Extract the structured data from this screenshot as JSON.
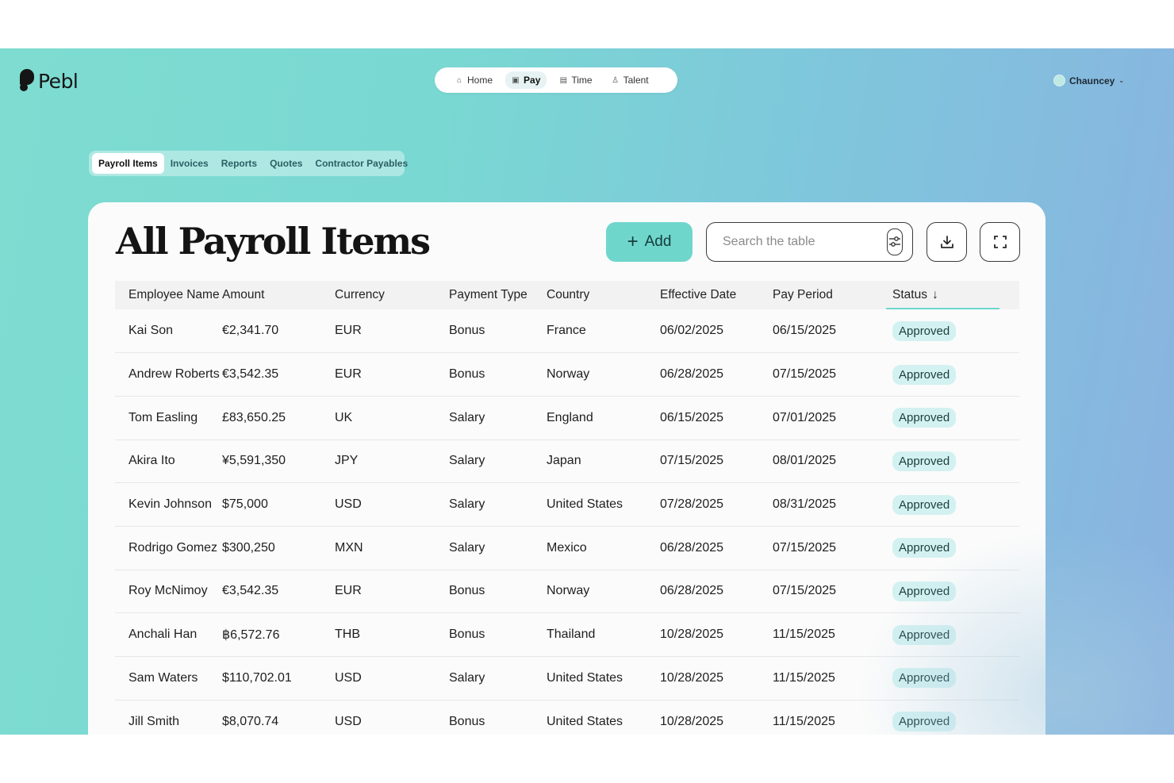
{
  "brand": {
    "name": "Pebl"
  },
  "topnav": {
    "items": [
      {
        "label": "Home",
        "icon": "home-icon"
      },
      {
        "label": "Pay",
        "icon": "wallet-icon",
        "active": true
      },
      {
        "label": "Time",
        "icon": "calendar-icon"
      },
      {
        "label": "Talent",
        "icon": "person-icon"
      }
    ]
  },
  "user": {
    "name": "Chauncey"
  },
  "subtabs": [
    {
      "label": "Payroll Items",
      "active": true
    },
    {
      "label": "Invoices"
    },
    {
      "label": "Reports"
    },
    {
      "label": "Quotes"
    },
    {
      "label": "Contractor Payables"
    }
  ],
  "main": {
    "title": "All Payroll Items",
    "add_label": "Add",
    "search_placeholder": "Search the table"
  },
  "table": {
    "columns": [
      "Employee Name",
      "Amount",
      "Currency",
      "Payment Type",
      "Country",
      "Effective Date",
      "Pay Period",
      "Status"
    ],
    "sorted_by": "Status",
    "rows": [
      {
        "name": "Kai Son",
        "amount": "€2,341.70",
        "currency": "EUR",
        "type": "Bonus",
        "country": "France",
        "effective": "06/02/2025",
        "period": "06/15/2025",
        "status": "Approved"
      },
      {
        "name": "Andrew Roberts",
        "amount": "€3,542.35",
        "currency": "EUR",
        "type": "Bonus",
        "country": "Norway",
        "effective": "06/28/2025",
        "period": "07/15/2025",
        "status": "Approved"
      },
      {
        "name": "Tom Easling",
        "amount": "£83,650.25",
        "currency": "UK",
        "type": "Salary",
        "country": "England",
        "effective": "06/15/2025",
        "period": "07/01/2025",
        "status": "Approved"
      },
      {
        "name": "Akira Ito",
        "amount": "¥5,591,350",
        "currency": "JPY",
        "type": "Salary",
        "country": "Japan",
        "effective": "07/15/2025",
        "period": "08/01/2025",
        "status": "Approved"
      },
      {
        "name": "Kevin Johnson",
        "amount": "$75,000",
        "currency": "USD",
        "type": "Salary",
        "country": "United States",
        "effective": "07/28/2025",
        "period": "08/31/2025",
        "status": "Approved"
      },
      {
        "name": "Rodrigo Gomez",
        "amount": "$300,250",
        "currency": "MXN",
        "type": "Salary",
        "country": "Mexico",
        "effective": "06/28/2025",
        "period": "07/15/2025",
        "status": "Approved"
      },
      {
        "name": "Roy McNimoy",
        "amount": "€3,542.35",
        "currency": "EUR",
        "type": "Bonus",
        "country": "Norway",
        "effective": "06/28/2025",
        "period": "07/15/2025",
        "status": "Approved"
      },
      {
        "name": "Anchali Han",
        "amount": "฿6,572.76",
        "currency": "THB",
        "type": "Bonus",
        "country": "Thailand",
        "effective": "10/28/2025",
        "period": "11/15/2025",
        "status": "Approved"
      },
      {
        "name": "Sam Waters",
        "amount": "$110,702.01",
        "currency": "USD",
        "type": "Salary",
        "country": "United States",
        "effective": "10/28/2025",
        "period": "11/15/2025",
        "status": "Approved"
      },
      {
        "name": "Jill Smith",
        "amount": "$8,070.74",
        "currency": "USD",
        "type": "Bonus",
        "country": "United States",
        "effective": "10/28/2025",
        "period": "11/15/2025",
        "status": "Approved"
      }
    ]
  },
  "colors": {
    "accent": "#6fd6cc",
    "badge_bg": "#d3f1f1",
    "gradient_start": "#7edcd1",
    "gradient_end": "#8ab2e0"
  }
}
